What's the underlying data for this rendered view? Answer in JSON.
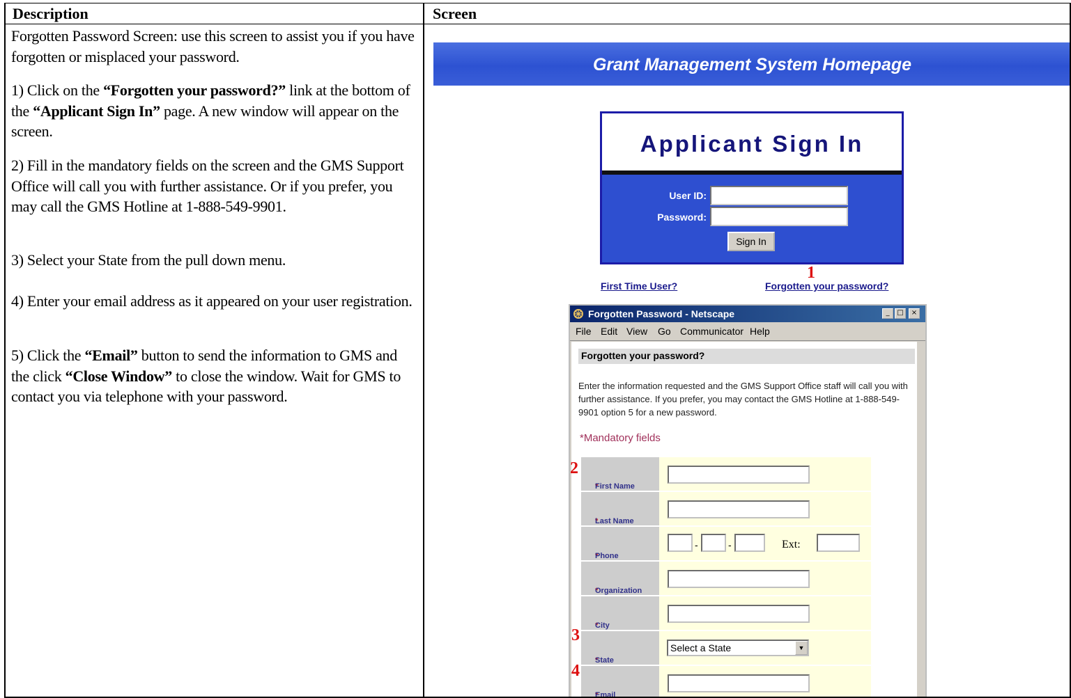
{
  "table": {
    "header_description": "Description",
    "header_screen": "Screen",
    "desc_intro": "Forgotten Password Screen: use this screen to assist you if you have forgotten or misplaced your password.",
    "step1_prefix": "1) Click on the ",
    "step1_link": "“Forgotten your password?”",
    "step1_mid": " link at the bottom of the ",
    "step1_page": "“Applicant Sign In”",
    "step1_suffix": " page.  A new window will appear on the screen.",
    "step2": "2) Fill in the mandatory fields on the screen and the GMS Support Office will call you with further assistance.  Or if you prefer, you may call the GMS Hotline at 1-888-549-9901.",
    "step3": "3) Select your State from the pull down menu.",
    "step4": "4) Enter your email address as it appeared on your user registration.",
    "step5_prefix": "5) Click the ",
    "step5_email": "“Email”",
    "step5_mid": " button to send the information to GMS and the click ",
    "step5_close": "“Close Window”",
    "step5_suffix": " to close the window.  Wait for GMS to contact you via telephone with your password."
  },
  "banner": {
    "title": "Grant Management System Homepage"
  },
  "signin": {
    "title": "Applicant Sign In",
    "user_id_label": "User  ID:",
    "password_label": "Password:",
    "button": "Sign In",
    "first_time_link": "First Time User?",
    "forgot_link": "Forgotten your password?"
  },
  "markers": {
    "m1": "1",
    "m2": "2",
    "m3": "3",
    "m4": "4"
  },
  "popup": {
    "window_title": "Forgotten Password - Netscape",
    "menu": {
      "file": "File",
      "edit": "Edit",
      "view": "View",
      "go": "Go",
      "communicator": "Communicator",
      "help": "Help"
    },
    "section_title": "Forgotten your password?",
    "intro": "Enter the information requested and the GMS Support Office staff will call you with further assistance. If you prefer, you may contact the GMS Hotline at 1-888-549-9901 option 5 for a new password.",
    "mandatory_note": "*Mandatory fields",
    "fields": {
      "first_name": "First Name",
      "last_name": "Last Name",
      "phone": "Phone",
      "organization": "Organization",
      "city": "City",
      "state": "State",
      "email": "Email"
    },
    "ext_label": "Ext:",
    "state_select_value": "Select a State"
  },
  "colors": {
    "banner_blue": "#2d52d2",
    "signin_navy": "#15157a",
    "marker_red": "#dd1111",
    "form_yellow": "#ffffe0"
  }
}
